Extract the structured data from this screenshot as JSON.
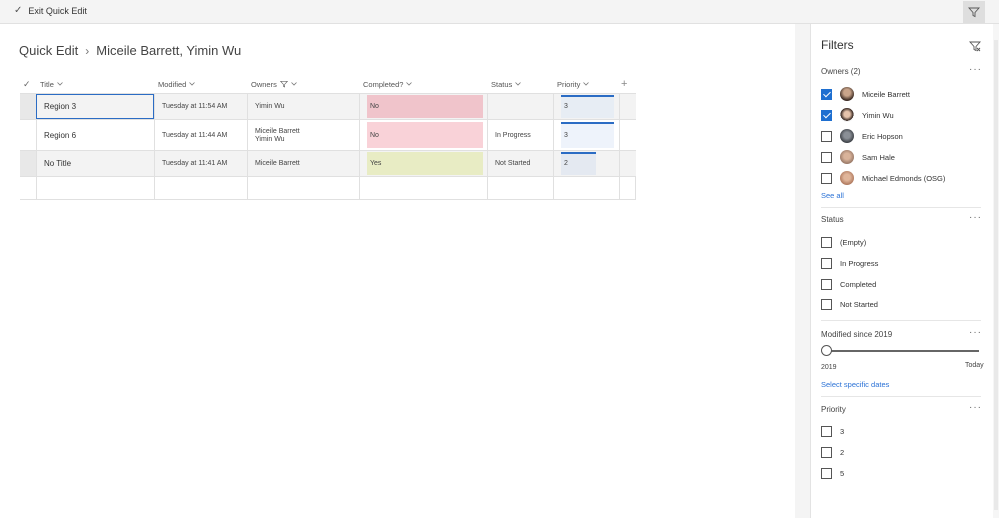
{
  "topbar": {
    "exit_label": "Exit Quick Edit"
  },
  "breadcrumb": {
    "root": "Quick Edit",
    "current": "Miceile Barrett, Yimin Wu"
  },
  "columns": {
    "title": "Title",
    "modified": "Modified",
    "owners": "Owners",
    "completed": "Completed?",
    "status": "Status",
    "priority": "Priority",
    "add": "+"
  },
  "rows": [
    {
      "title": "Region 3",
      "modified": "Tuesday at 11:54 AM",
      "owners": [
        "Yimin Wu"
      ],
      "completed": "No",
      "status": "",
      "priority": "3"
    },
    {
      "title": "Region 6",
      "modified": "Tuesday at 11:44 AM",
      "owners": [
        "Miceile Barrett",
        "Yimin Wu"
      ],
      "completed": "No",
      "status": "In Progress",
      "priority": "3"
    },
    {
      "title": "No Title",
      "modified": "Tuesday at 11:41 AM",
      "owners": [
        "Miceile Barrett"
      ],
      "completed": "Yes",
      "status": "Not Started",
      "priority": "2"
    }
  ],
  "colors": {
    "accent": "#1e6fd0",
    "no_cell": "#f7c9d0",
    "no_cell_alt": "#f9d2d8",
    "yes_cell": "#e8ecc4",
    "priority_cell": "#e7edf4"
  },
  "filters": {
    "title": "Filters",
    "owners": {
      "label": "Owners (2)",
      "items": [
        {
          "name": "Miceile Barrett",
          "checked": true
        },
        {
          "name": "Yimin Wu",
          "checked": true
        },
        {
          "name": "Eric Hopson",
          "checked": false
        },
        {
          "name": "Sam Hale",
          "checked": false
        },
        {
          "name": "Michael Edmonds (OSG)",
          "checked": false
        }
      ],
      "see_all": "See all"
    },
    "status": {
      "label": "Status",
      "items": [
        "(Empty)",
        "In Progress",
        "Completed",
        "Not Started"
      ]
    },
    "modified": {
      "label": "Modified since 2019",
      "min_label": "2019",
      "max_label": "Today",
      "link": "Select specific dates"
    },
    "priority": {
      "label": "Priority",
      "items": [
        "3",
        "2",
        "5"
      ]
    },
    "more": "···"
  }
}
